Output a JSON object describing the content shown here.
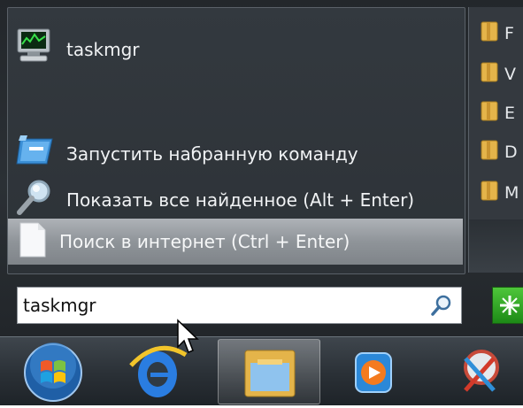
{
  "results": {
    "taskmgr_label": "taskmgr",
    "run_label": "Запустить набранную команду",
    "show_all_label": "Показать все найденное (Alt + Enter)",
    "web_search_label": "Поиск в интернет (Ctrl + Enter)"
  },
  "right_pane": {
    "folders": [
      "F",
      "V",
      "E",
      "D",
      "M"
    ]
  },
  "search": {
    "value": "taskmgr"
  },
  "taskbar": {
    "items": [
      "start-orb",
      "internet-explorer",
      "windows-explorer",
      "media-player",
      "snipping-tool"
    ]
  },
  "icons": {
    "search": "search-icon",
    "taskmgr": "monitor-icon",
    "run": "run-command-icon",
    "show_all": "magnifier-icon",
    "web_search": "document-icon",
    "folder": "folder-icon",
    "shutdown": "shutdown-icon"
  },
  "colors": {
    "menu_bg": "#2b3035",
    "highlight": "#9a9fa4",
    "text": "#f0f2f4"
  }
}
